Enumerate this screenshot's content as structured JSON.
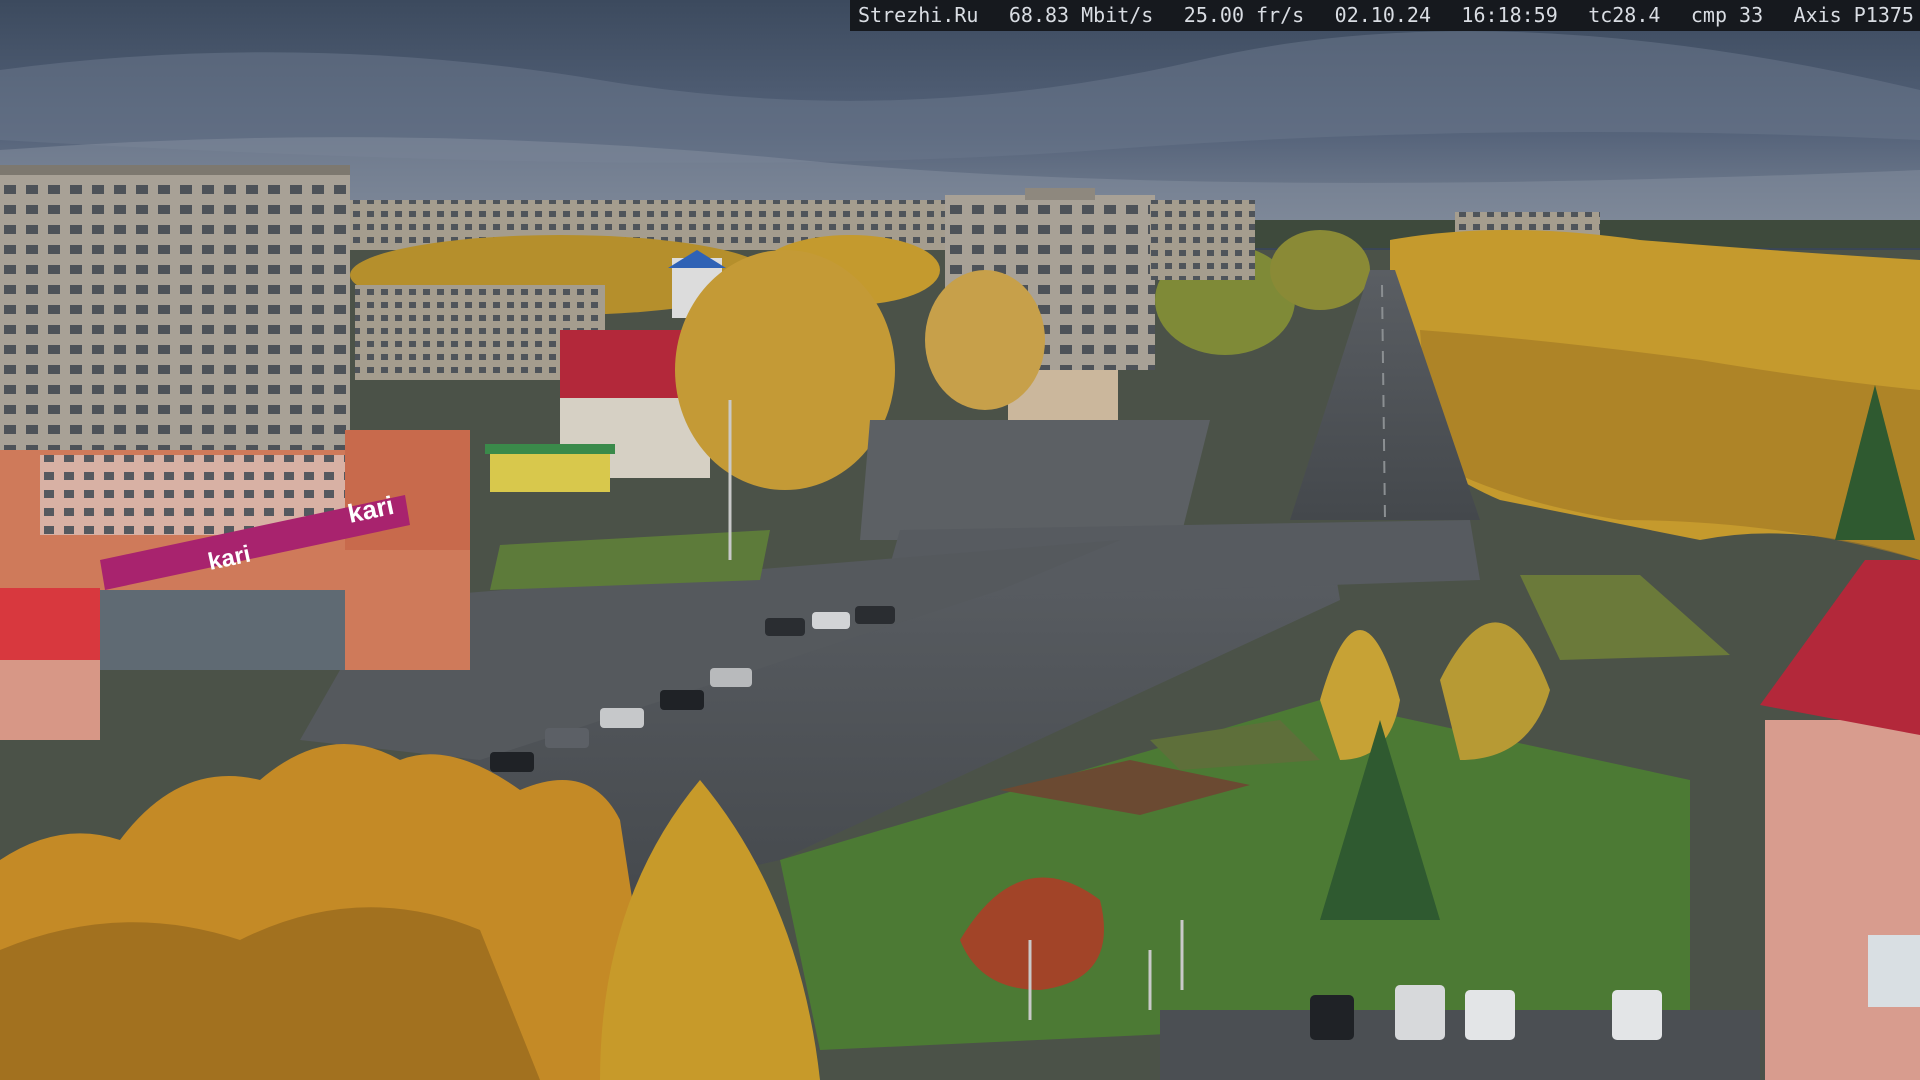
{
  "overlay": {
    "site": "Strezhi.Ru",
    "bitrate": "68.83 Mbit/s",
    "fps": "25.00 fr/s",
    "date": "02.10.24",
    "time": "16:18:59",
    "tc": "tc28.4",
    "cmp": "cmp 33",
    "camera": "Axis P1375"
  },
  "signage": {
    "store_logo": "kari",
    "store_logo_lower": "kari"
  },
  "colors": {
    "sky": "#46546a",
    "overcast": "#5e6c80",
    "foliage": "#c9962a",
    "store_banner": "#a8236e",
    "roof_red": "#b3283a",
    "asphalt": "#4f5357",
    "grass": "#4f7a34"
  }
}
